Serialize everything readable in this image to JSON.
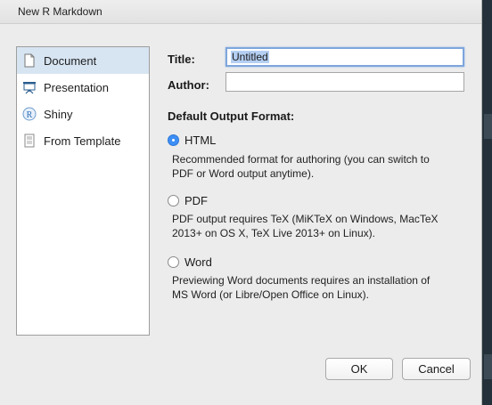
{
  "window": {
    "title": "New R Markdown"
  },
  "sidebar": {
    "items": [
      {
        "label": "Document",
        "icon": "document-icon",
        "selected": true
      },
      {
        "label": "Presentation",
        "icon": "presentation-icon",
        "selected": false
      },
      {
        "label": "Shiny",
        "icon": "shiny-icon",
        "selected": false
      },
      {
        "label": "From Template",
        "icon": "template-icon",
        "selected": false
      }
    ]
  },
  "form": {
    "title_label": "Title:",
    "title_value": "Untitled",
    "author_label": "Author:",
    "author_value": ""
  },
  "output": {
    "heading": "Default Output Format:",
    "options": [
      {
        "label": "HTML",
        "checked": true,
        "desc": [
          "Recommended format for authoring (you can switch to",
          "PDF or Word output anytime)."
        ]
      },
      {
        "label": "PDF",
        "checked": false,
        "desc": [
          "PDF output requires TeX (MiKTeX on Windows, MacTeX",
          "2013+ on OS X, TeX Live 2013+ on Linux)."
        ]
      },
      {
        "label": "Word",
        "checked": false,
        "desc": [
          "Previewing Word documents requires an installation of",
          "MS Word (or Libre/Open Office on Linux)."
        ]
      }
    ]
  },
  "buttons": {
    "ok_label": "OK",
    "cancel_label": "Cancel"
  },
  "colors": {
    "accent": "#3d8ef5",
    "selection": "#d7e4f2"
  }
}
